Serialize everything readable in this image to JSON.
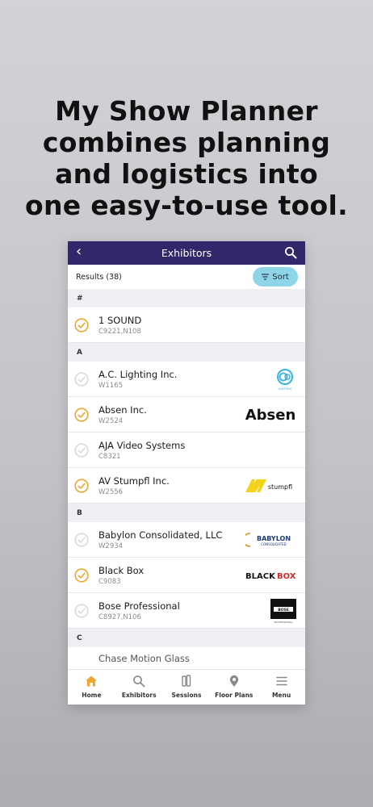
{
  "headline": {
    "line1": "My Show Planner",
    "line2": "combines planning",
    "line3": "and logistics into",
    "line4": "one easy-to-use tool."
  },
  "navbar": {
    "title": "Exhibitors",
    "back_icon": "chevron-left-icon",
    "search_icon": "search-icon"
  },
  "results": {
    "count_label": "Results (38)",
    "sort_label": "Sort",
    "sort_icon": "sort-lines-icon"
  },
  "sections": [
    {
      "letter": "#",
      "rows": [
        {
          "name": "1 SOUND",
          "booth": "C9221,N108",
          "selected": true,
          "logo": ""
        }
      ]
    },
    {
      "letter": "A",
      "rows": [
        {
          "name": "A.C. Lighting Inc.",
          "booth": "W1165",
          "selected": false,
          "logo": "ac-lighting"
        },
        {
          "name": "Absen Inc.",
          "booth": "W2524",
          "selected": true,
          "logo": "absen"
        },
        {
          "name": "AJA Video Systems",
          "booth": "C8321",
          "selected": false,
          "logo": ""
        },
        {
          "name": "AV Stumpfl Inc.",
          "booth": "W2556",
          "selected": true,
          "logo": "av-stumpfl"
        }
      ]
    },
    {
      "letter": "B",
      "rows": [
        {
          "name": "Babylon Consolidated, LLC",
          "booth": "W2934",
          "selected": false,
          "logo": "babylon"
        },
        {
          "name": "Black Box",
          "booth": "C9083",
          "selected": true,
          "logo": "black-box"
        },
        {
          "name": "Bose Professional",
          "booth": "C8927,N106",
          "selected": false,
          "logo": "bose"
        }
      ]
    },
    {
      "letter": "C",
      "rows": [
        {
          "name": "Chase Motion Glass",
          "booth": "",
          "selected": false,
          "logo": ""
        }
      ]
    }
  ],
  "logos": {
    "absen": "Absen",
    "av_stumpfl": "stumpfl",
    "babylon": "BABYLON",
    "babylon_sub": "CONSOLIDATED",
    "black_box_1": "BLACK",
    "black_box_2": "BOX",
    "bose": "BOSE",
    "bose_sub": "PROFESSIONAL",
    "ac_sub": "LIGHTING"
  },
  "tabs": [
    {
      "label": "Home",
      "icon": "home-icon",
      "active": true
    },
    {
      "label": "Exhibitors",
      "icon": "search-icon",
      "active": false
    },
    {
      "label": "Sessions",
      "icon": "sessions-icon",
      "active": false
    },
    {
      "label": "Floor Plans",
      "icon": "map-pin-icon",
      "active": false
    },
    {
      "label": "Menu",
      "icon": "hamburger-icon",
      "active": false
    }
  ],
  "colors": {
    "navbar": "#30286b",
    "check_selected": "#f0a630",
    "check_unselected": "#d9d9dd",
    "sort_button": "#8fd5ea",
    "active_tab": "#f0a630",
    "inactive_tab": "#8a8a8e"
  }
}
